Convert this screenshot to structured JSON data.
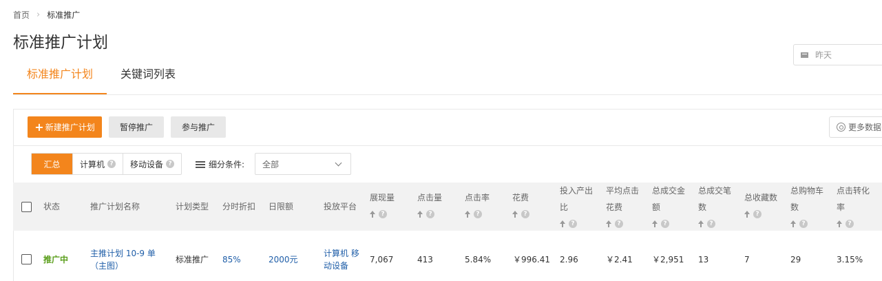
{
  "breadcrumb": {
    "home": "首页",
    "current": "标准推广"
  },
  "page_title": "标准推广计划",
  "date_picker": {
    "value": "昨天"
  },
  "tabs": [
    {
      "label": "标准推广计划",
      "active": true
    },
    {
      "label": "关键词列表",
      "active": false
    }
  ],
  "toolbar": {
    "new_plan": "新建推广计划",
    "pause": "暂停推广",
    "join": "参与推广",
    "more_data": "更多数据"
  },
  "segments": [
    {
      "label": "汇总",
      "active": true
    },
    {
      "label": "计算机",
      "active": false
    },
    {
      "label": "移动设备",
      "active": false
    }
  ],
  "filter": {
    "label": "细分条件:",
    "value": "全部"
  },
  "table": {
    "headers": {
      "status": "状态",
      "name": "推广计划名称",
      "type": "计划类型",
      "discount": "分时折扣",
      "limit": "日限额",
      "platform": "投放平台",
      "impressions": "展现量",
      "clicks": "点击量",
      "ctr": "点击率",
      "cost": "花费",
      "roi_1": "投入产出",
      "roi_2": "比",
      "cpc_1": "平均点击",
      "cpc_2": "花费",
      "gmv_1": "总成交金",
      "gmv_2": "额",
      "orders_1": "总成交笔",
      "orders_2": "数",
      "favorites": "总收藏数",
      "cart_1": "总购物车",
      "cart_2": "数",
      "cvr_1": "点击转化",
      "cvr_2": "率"
    },
    "rows": [
      {
        "status": "推广中",
        "name_1": "主推计划 10-9 单",
        "name_2": "（主图）",
        "type": "标准推广",
        "discount": "85%",
        "limit": "2000元",
        "platform_1": "计算机 移",
        "platform_2": "动设备",
        "impressions": "7,067",
        "clicks": "413",
        "ctr": "5.84%",
        "cost": "￥996.41",
        "roi": "2.96",
        "cpc": "￥2.41",
        "gmv": "￥2,951",
        "orders": "13",
        "favorites": "7",
        "cart": "29",
        "cvr": "3.15%"
      }
    ]
  },
  "colors": {
    "accent": "#f3851c",
    "link": "#1f5ea8",
    "status_active": "#5a9e1b"
  }
}
